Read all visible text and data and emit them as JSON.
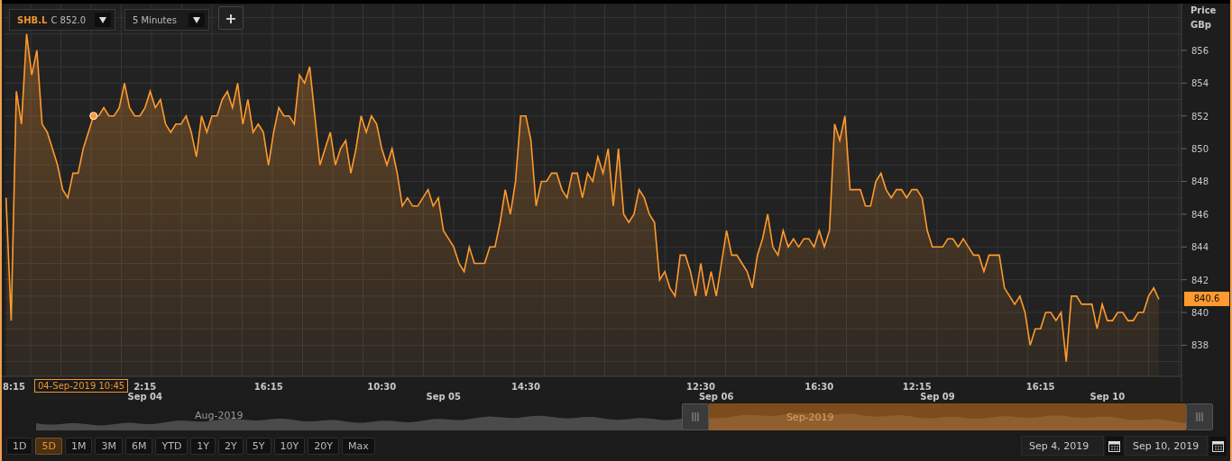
{
  "toolbar": {
    "symbol": "SHB.L",
    "quote": "C 852.0",
    "interval": "5 Minutes",
    "add_button": "+"
  },
  "chart": {
    "axis_unit": "GBp",
    "last_price": "840.6",
    "tooltip": "04-Sep-2019 10:45",
    "time_labels": [
      "8:15",
      "2:15",
      "16:15",
      "10:30",
      "14:30",
      "12:30",
      "16:30",
      "12:15",
      "16:15"
    ],
    "day_labels": [
      "Sep 04",
      "Sep 05",
      "Sep 06",
      "Sep 09",
      "Sep 10"
    ],
    "chart_data": {
      "type": "area",
      "ylabel": "Price",
      "ylim": [
        836.1,
        858.8
      ],
      "grid": true,
      "yticks": [
        838,
        840,
        842,
        844,
        846,
        848,
        850,
        852,
        854,
        856
      ],
      "series": [
        {
          "color": "#ff9a2e",
          "values": [
            847,
            839.5,
            853.5,
            851.5,
            857,
            854.5,
            856,
            851.5,
            851,
            850,
            849,
            847.5,
            847,
            848.5,
            848.5,
            850,
            851,
            852,
            852,
            852.5,
            852,
            852,
            852.5,
            854,
            852.5,
            852,
            852,
            852.5,
            853.5,
            852.5,
            853,
            851.5,
            851,
            851.5,
            851.5,
            852,
            851,
            849.5,
            852,
            851,
            852,
            852,
            853,
            853.5,
            852.5,
            854,
            851.5,
            853,
            851,
            851.5,
            851,
            849,
            851,
            852.5,
            852,
            852,
            851.5,
            854.5,
            854,
            855,
            852,
            849,
            850,
            851,
            849,
            850,
            850.5,
            848.5,
            850,
            852,
            851,
            852,
            851.5,
            850,
            849,
            850,
            848.5,
            846.5,
            847,
            846.5,
            846.5,
            847,
            847.5,
            846.5,
            847,
            845,
            844.5,
            844,
            843,
            842.5,
            844,
            843,
            843,
            843,
            844,
            844,
            845.5,
            847.5,
            846,
            848,
            852,
            852,
            850.5,
            846.5,
            848,
            848,
            848.5,
            848.5,
            847.5,
            847,
            848.5,
            848.5,
            847,
            848.5,
            848,
            849.5,
            848.5,
            850,
            846.5,
            850,
            846,
            845.5,
            846,
            847.5,
            847,
            846,
            845.5,
            842,
            842.5,
            841.5,
            841,
            843.5,
            843.5,
            842.5,
            841,
            843,
            841,
            842.5,
            841,
            843,
            845,
            843.5,
            843.5,
            843,
            842.5,
            841.5,
            843.5,
            844.5,
            846,
            844,
            843.5,
            845,
            844,
            844.5,
            844,
            844.5,
            844.5,
            844,
            845,
            844,
            845,
            851.5,
            850.5,
            852,
            847.5,
            847.5,
            847.5,
            846.5,
            846.5,
            848,
            848.5,
            847.5,
            847,
            847.5,
            847.5,
            847,
            847.5,
            847.5,
            847,
            845,
            844,
            844,
            844,
            844.5,
            844.5,
            844,
            844.5,
            844,
            843.5,
            843.5,
            842.5,
            843.5,
            843.5,
            843.5,
            841.5,
            841,
            840.5,
            841,
            840,
            838,
            839,
            839,
            840,
            840,
            839.5,
            840,
            837,
            841,
            841,
            840.5,
            840.5,
            840.5,
            839,
            840.5,
            839.5,
            839.5,
            840,
            840,
            839.5,
            839.5,
            840,
            840,
            841,
            841.5,
            840.8
          ]
        }
      ]
    }
  },
  "navigator": {
    "left_label": "Aug-2019",
    "right_label": "Sep-2019"
  },
  "ranges": [
    {
      "label": "1D",
      "selected": false
    },
    {
      "label": "5D",
      "selected": true
    },
    {
      "label": "1M",
      "selected": false
    },
    {
      "label": "3M",
      "selected": false
    },
    {
      "label": "6M",
      "selected": false
    },
    {
      "label": "YTD",
      "selected": false
    },
    {
      "label": "1Y",
      "selected": false
    },
    {
      "label": "2Y",
      "selected": false
    },
    {
      "label": "5Y",
      "selected": false
    },
    {
      "label": "10Y",
      "selected": false
    },
    {
      "label": "20Y",
      "selected": false
    },
    {
      "label": "Max",
      "selected": false
    }
  ],
  "date_range": {
    "from": "Sep 4, 2019",
    "to": "Sep 10, 2019"
  }
}
